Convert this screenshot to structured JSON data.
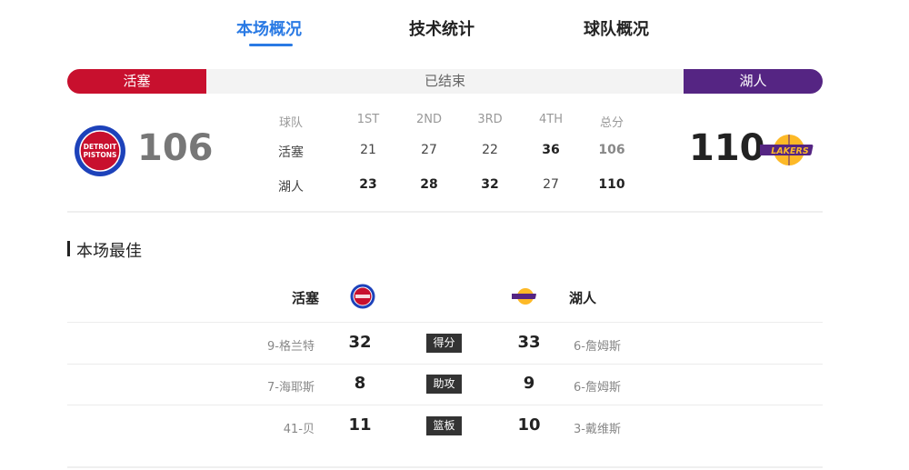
{
  "tabs": [
    {
      "label": "本场概况"
    },
    {
      "label": "技术统计"
    },
    {
      "label": "球队概况"
    }
  ],
  "status": {
    "home_team": "活塞",
    "state": "已结束",
    "away_team": "湖人",
    "home_color": "#c8102e",
    "away_color": "#552583"
  },
  "home": {
    "name": "活塞",
    "score": "106",
    "logo_text_top": "DETROIT",
    "logo_text_bottom": "PISTONS"
  },
  "away": {
    "name": "湖人",
    "score": "110",
    "logo_text": "LAKERS"
  },
  "quarters": {
    "headers": [
      "球队",
      "1ST",
      "2ND",
      "3RD",
      "4TH",
      "总分"
    ],
    "home_row": [
      "活塞",
      "21",
      "27",
      "22",
      "36",
      "106"
    ],
    "away_row": [
      "湖人",
      "23",
      "28",
      "32",
      "27",
      "110"
    ]
  },
  "best": {
    "title": "本场最佳",
    "home_team": "活塞",
    "away_team": "湖人",
    "rows": [
      {
        "home_player": "9-格兰特",
        "home_value": "32",
        "stat": "得分",
        "away_value": "33",
        "away_player": "6-詹姆斯"
      },
      {
        "home_player": "7-海耶斯",
        "home_value": "8",
        "stat": "助攻",
        "away_value": "9",
        "away_player": "6-詹姆斯"
      },
      {
        "home_player": "41-贝",
        "home_value": "11",
        "stat": "篮板",
        "away_value": "10",
        "away_player": "3-戴维斯"
      }
    ]
  }
}
